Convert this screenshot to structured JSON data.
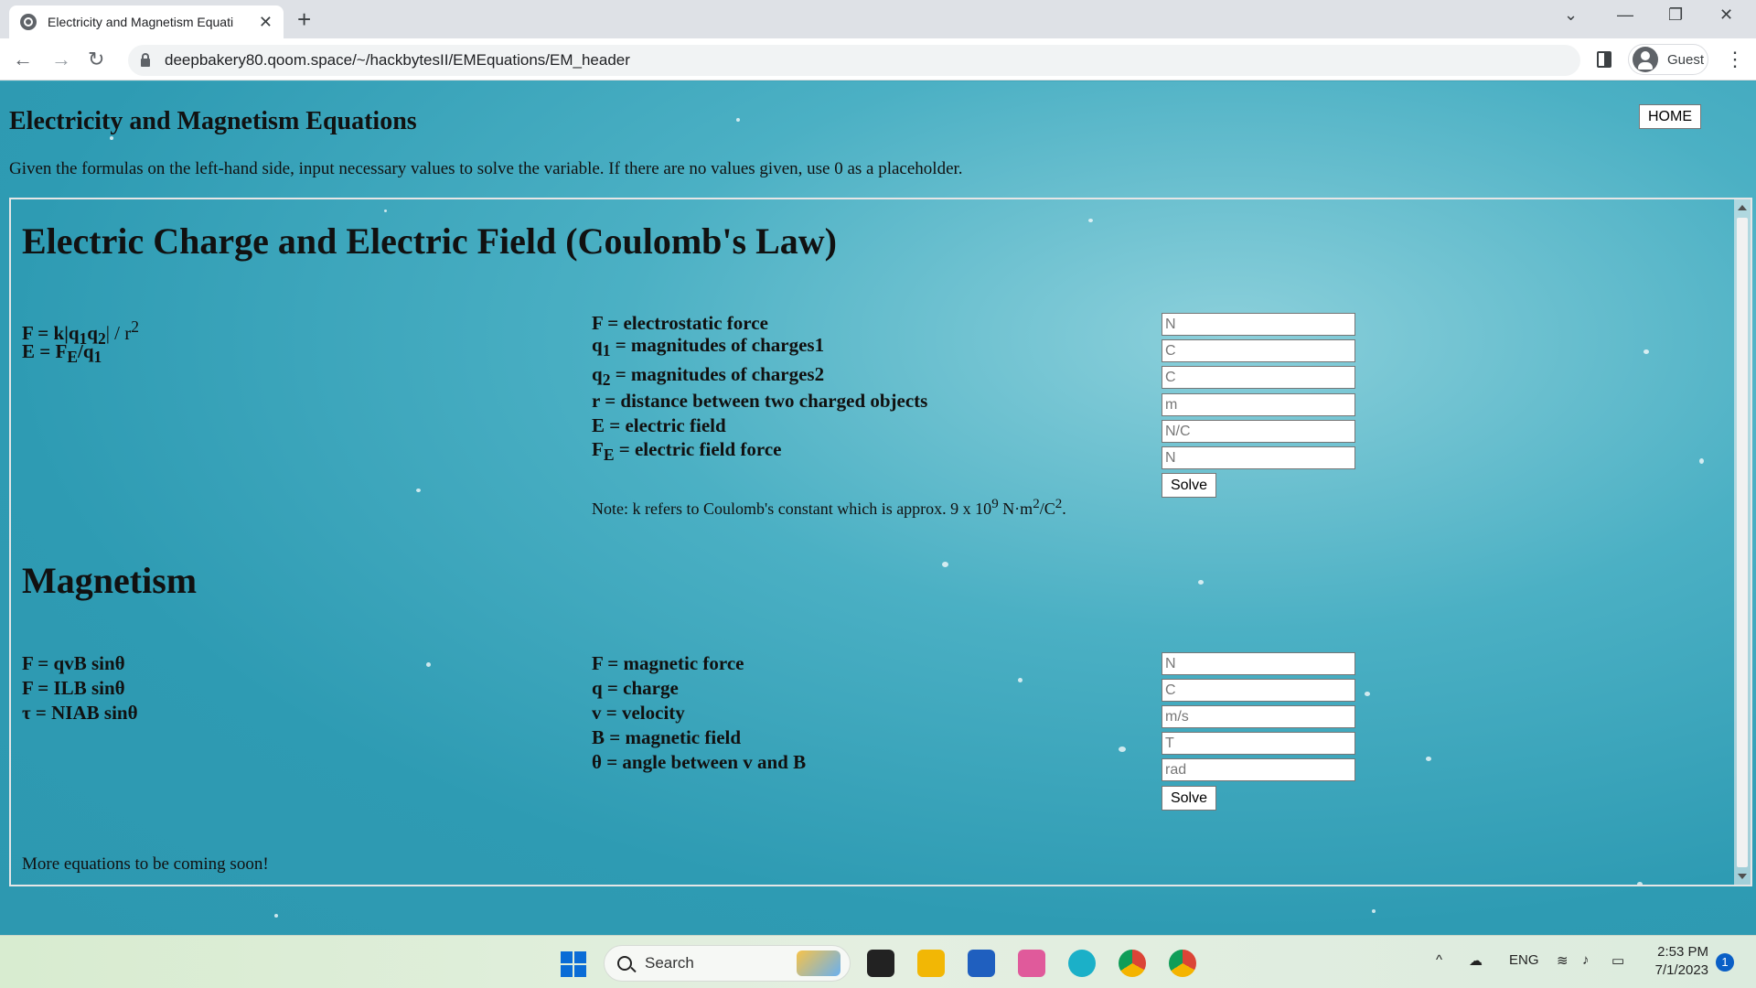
{
  "browser": {
    "tab_title": "Electricity and Magnetism Equati",
    "url": "deepbakery80.qoom.space/~/hackbytesII/EMEquations/EM_header",
    "profile_label": "Guest"
  },
  "page": {
    "title": "Electricity and Magnetism Equations",
    "home_label": "HOME",
    "intro": "Given the formulas on the left-hand side, input necessary values to solve the variable. If there are no values given, use 0 as a placeholder."
  },
  "coulomb": {
    "title": "Electric Charge and Electric Field (Coulomb's Law)",
    "formulas": {
      "f1_main": "F = k|q",
      "f1_s1": "1",
      "f1_mid": "q",
      "f1_s2": "2",
      "f1_tail": "| / r",
      "f1_exp": "2",
      "f2_main": "E = F",
      "f2_sub_e": "E",
      "f2_mid": "/q",
      "f2_sub_1": "1"
    },
    "variables": {
      "v1": "F = electrostatic force",
      "v2_sym": "q",
      "v2_sub": "1",
      "v2_text": " = magnitudes of charges1",
      "v3_sym": "q",
      "v3_sub": "2",
      "v3_text": " = magnitudes of charges2",
      "v4": "r = distance between two charged objects",
      "v5": "E = electric field",
      "v6_sym": "F",
      "v6_sub": "E",
      "v6_text": " = electric field force"
    },
    "inputs": [
      "N",
      "C",
      "C",
      "m",
      "N/C",
      "N"
    ],
    "solve_label": "Solve",
    "note_pre": "Note: k refers to Coulomb's constant which is approx. 9 x 10",
    "note_exp9": "9",
    "note_mid": " N·m",
    "note_exp2a": "2",
    "note_mid2": "/C",
    "note_exp2b": "2",
    "note_end": "."
  },
  "magnetism": {
    "title": "Magnetism",
    "formulas": [
      "F = qvB sinθ",
      "F = ILB sinθ",
      "τ = NIAB sinθ"
    ],
    "variables": [
      "F = magnetic force",
      "q = charge",
      "v = velocity",
      "B = magnetic field",
      "θ = angle between v and B"
    ],
    "inputs": [
      "N",
      "C",
      "m/s",
      "T",
      "rad"
    ],
    "solve_label": "Solve"
  },
  "footer_note": "More equations to be coming soon!",
  "taskbar": {
    "search_label": "Search",
    "lang": "ENG",
    "time": "2:53 PM",
    "date": "7/1/2023",
    "notification_count": "1"
  }
}
